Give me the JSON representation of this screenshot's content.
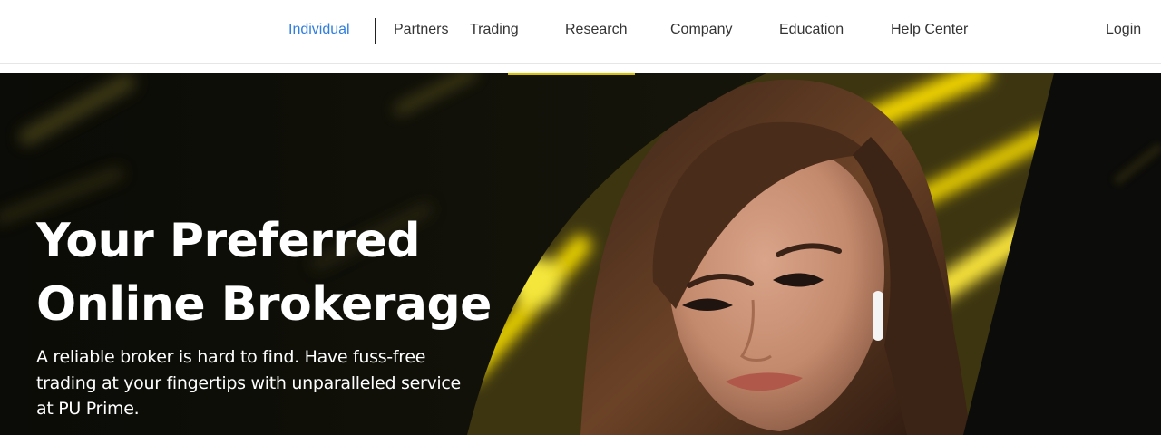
{
  "header": {
    "nav_items": [
      {
        "label": "Individual",
        "active": true
      },
      {
        "label": "Partners"
      },
      {
        "label": "Trading"
      },
      {
        "label": "Research"
      },
      {
        "label": "Company"
      },
      {
        "label": "Education"
      },
      {
        "label": "Help Center"
      }
    ],
    "login_label": "Login",
    "active_color": "#2f7de1"
  },
  "hero": {
    "title_line1": "Your Preferred",
    "title_line2": "Online Brokerage",
    "subtitle": "A reliable broker is hard to find. Have fuss-free trading at your fingertips with unparalleled service at PU Prime.",
    "accent_color": "#f2d500"
  }
}
